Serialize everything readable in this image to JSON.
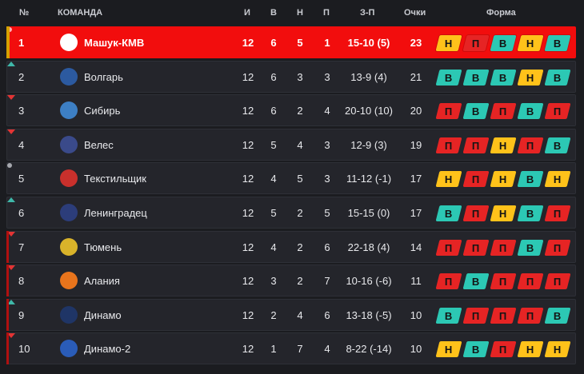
{
  "headers": {
    "pos": "№",
    "team": "КОМАНДА",
    "games": "И",
    "wins": "В",
    "draws": "Н",
    "losses": "П",
    "goals": "З-П",
    "points": "Очки",
    "form": "Форма"
  },
  "rows": [
    {
      "pos": "1",
      "trend": "same",
      "team": "Машук-КМВ",
      "logo": "shield-red",
      "logo_color": "#ffffff",
      "games": "12",
      "w": "6",
      "d": "5",
      "l": "1",
      "goals": "15-10 (5)",
      "pts": "23",
      "form": [
        "Н",
        "П",
        "В",
        "Н",
        "В"
      ],
      "highlight": true,
      "edge": "gold"
    },
    {
      "pos": "2",
      "trend": "up",
      "team": "Волгарь",
      "logo": "ball-blue",
      "logo_color": "#2c5aa0",
      "games": "12",
      "w": "6",
      "d": "3",
      "l": "3",
      "goals": "13-9 (4)",
      "pts": "21",
      "form": [
        "В",
        "В",
        "В",
        "Н",
        "В"
      ],
      "highlight": false,
      "edge": ""
    },
    {
      "pos": "3",
      "trend": "down",
      "team": "Сибирь",
      "logo": "shield-blue",
      "logo_color": "#3d7fc4",
      "games": "12",
      "w": "6",
      "d": "2",
      "l": "4",
      "goals": "20-10 (10)",
      "pts": "20",
      "form": [
        "П",
        "В",
        "П",
        "В",
        "П"
      ],
      "highlight": false,
      "edge": ""
    },
    {
      "pos": "4",
      "trend": "down",
      "team": "Велес",
      "logo": "wings",
      "logo_color": "#3a4a8a",
      "games": "12",
      "w": "5",
      "d": "4",
      "l": "3",
      "goals": "12-9 (3)",
      "pts": "19",
      "form": [
        "П",
        "П",
        "Н",
        "П",
        "В"
      ],
      "highlight": false,
      "edge": ""
    },
    {
      "pos": "5",
      "trend": "same",
      "team": "Текстильщик",
      "logo": "shield-red",
      "logo_color": "#c9302c",
      "games": "12",
      "w": "4",
      "d": "5",
      "l": "3",
      "goals": "11-12 (-1)",
      "pts": "17",
      "form": [
        "Н",
        "П",
        "Н",
        "В",
        "Н"
      ],
      "highlight": false,
      "edge": ""
    },
    {
      "pos": "6",
      "trend": "up",
      "team": "Ленинградец",
      "logo": "ship",
      "logo_color": "#2c3d7a",
      "games": "12",
      "w": "5",
      "d": "2",
      "l": "5",
      "goals": "15-15 (0)",
      "pts": "17",
      "form": [
        "В",
        "П",
        "Н",
        "В",
        "П"
      ],
      "highlight": false,
      "edge": ""
    },
    {
      "pos": "7",
      "trend": "down",
      "team": "Тюмень",
      "logo": "crest-gold",
      "logo_color": "#d9b32a",
      "games": "12",
      "w": "4",
      "d": "2",
      "l": "6",
      "goals": "22-18 (4)",
      "pts": "14",
      "form": [
        "П",
        "П",
        "П",
        "В",
        "П"
      ],
      "highlight": false,
      "edge": "red"
    },
    {
      "pos": "8",
      "trend": "down",
      "team": "Алания",
      "logo": "crest-orange",
      "logo_color": "#e8741c",
      "games": "12",
      "w": "3",
      "d": "2",
      "l": "7",
      "goals": "10-16 (-6)",
      "pts": "11",
      "form": [
        "П",
        "В",
        "П",
        "П",
        "П"
      ],
      "highlight": false,
      "edge": "red"
    },
    {
      "pos": "9",
      "trend": "up",
      "team": "Динамо",
      "logo": "diamond",
      "logo_color": "#1f3566",
      "games": "12",
      "w": "2",
      "d": "4",
      "l": "6",
      "goals": "13-18 (-5)",
      "pts": "10",
      "form": [
        "В",
        "П",
        "П",
        "П",
        "В"
      ],
      "highlight": false,
      "edge": "red"
    },
    {
      "pos": "10",
      "trend": "down",
      "team": "Динамо-2",
      "logo": "letter-d",
      "logo_color": "#2a5cb8",
      "games": "12",
      "w": "1",
      "d": "7",
      "l": "4",
      "goals": "8-22 (-14)",
      "pts": "10",
      "form": [
        "Н",
        "В",
        "П",
        "Н",
        "Н"
      ],
      "highlight": false,
      "edge": "red"
    }
  ]
}
